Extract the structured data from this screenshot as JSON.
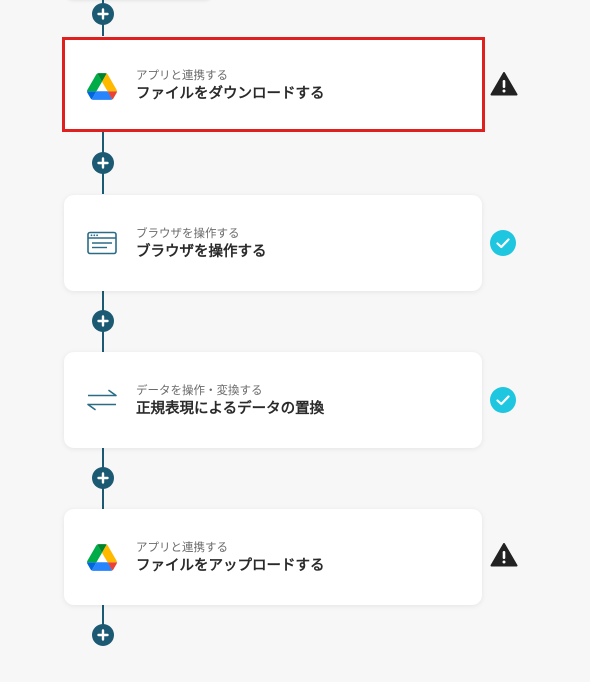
{
  "steps": [
    {
      "subtitle": "アプリと連携する",
      "title": "ファイルをダウンロードする",
      "icon": "google-drive-icon",
      "status": "warning",
      "selected": true
    },
    {
      "subtitle": "ブラウザを操作する",
      "title": "ブラウザを操作する",
      "icon": "browser-window-icon",
      "status": "complete",
      "selected": false
    },
    {
      "subtitle": "データを操作・変換する",
      "title": "正規表現によるデータの置換",
      "icon": "swap-arrows-icon",
      "status": "complete",
      "selected": false
    },
    {
      "subtitle": "アプリと連携する",
      "title": "ファイルをアップロードする",
      "icon": "google-drive-icon",
      "status": "warning",
      "selected": false
    }
  ],
  "colors": {
    "connector": "#1c5a73",
    "selected_border": "#e0201f",
    "complete": "#1fc6df",
    "warning": "#222222"
  }
}
